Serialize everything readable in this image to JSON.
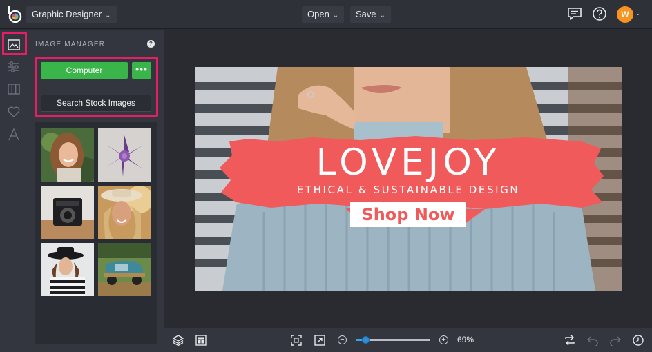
{
  "topbar": {
    "app_mode": "Graphic Designer",
    "open_label": "Open",
    "save_label": "Save",
    "user_initial": "W"
  },
  "sidebar_rail": {
    "items": [
      {
        "name": "image",
        "active": true
      },
      {
        "name": "adjust"
      },
      {
        "name": "layout"
      },
      {
        "name": "favorites"
      },
      {
        "name": "text"
      }
    ]
  },
  "panel": {
    "title": "IMAGE MANAGER",
    "computer_label": "Computer",
    "more_label": "•••",
    "stock_label": "Search Stock Images",
    "thumbnails": [
      "woman-smiling",
      "succulent",
      "camera",
      "woman-hat-sunlight",
      "woman-black-hat",
      "vintage-truck"
    ]
  },
  "canvas": {
    "brand": "LOVEJOY",
    "tagline": "ETHICAL & SUSTAINABLE DESIGN",
    "cta": "Shop Now",
    "accent": "#f05a5b"
  },
  "bottombar": {
    "zoom_level": "69%",
    "zoom_fraction": 0.13
  },
  "colors": {
    "highlight": "#e51e66",
    "primary_button": "#3ab54a",
    "avatar": "#f7931e"
  }
}
